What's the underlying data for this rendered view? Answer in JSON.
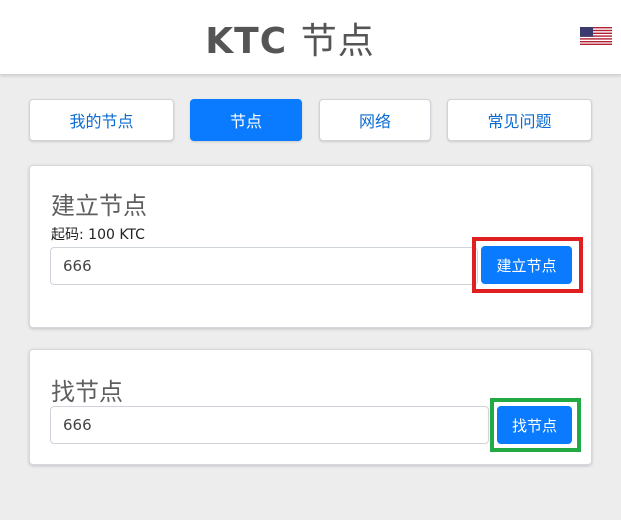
{
  "header": {
    "title_latin": "KTC",
    "title_cn": "节点",
    "flag_icon": "us-flag-icon"
  },
  "tabs": [
    {
      "label": "我的节点",
      "active": false
    },
    {
      "label": "节点",
      "active": true
    },
    {
      "label": "网络",
      "active": false
    },
    {
      "label": "常见问题",
      "active": false
    }
  ],
  "create_node": {
    "title": "建立节点",
    "min_label": "起码: 100 KTC",
    "input_value": "666",
    "button_label": "建立节点",
    "highlight_color": "#e02020"
  },
  "find_node": {
    "title": "找节点",
    "input_value": "666",
    "button_label": "找节点",
    "highlight_color": "#22aa44"
  },
  "colors": {
    "primary": "#0a7bff",
    "background": "#ededee",
    "link": "#0c6bd1"
  }
}
